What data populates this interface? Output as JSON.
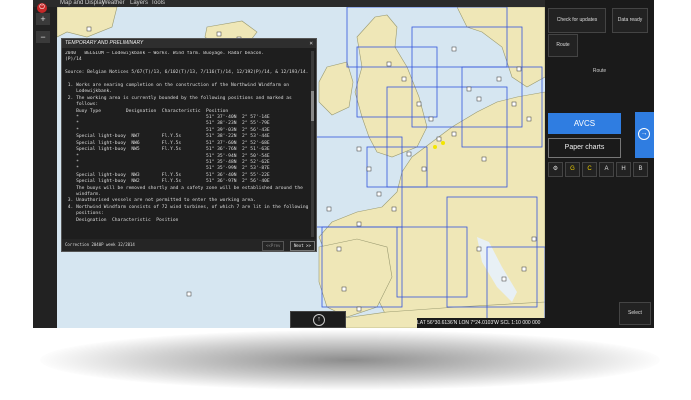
{
  "menu": {
    "items": [
      "Map and Display",
      "Weather",
      "Layers",
      "Tools"
    ]
  },
  "left_toolbar": {
    "zoom_in": "+",
    "zoom_out": "−",
    "logo": "⏻"
  },
  "right_panel": {
    "check_updates": "Check for updates",
    "data_ready": "Data ready",
    "route_button": "Route",
    "route_label": "Route",
    "avcs": "AVCS",
    "paper_charts": "Paper charts",
    "arrow": "→",
    "filters": [
      "⚙",
      "G",
      "C",
      "A",
      "H",
      "B"
    ],
    "select": "Select"
  },
  "notice": {
    "header": "TEMPORARY AND PRELIMINARY",
    "close": "×",
    "body": "2040   BELGIUM — Lodewijkbank — Works. Wind farm. Buoyage. Radar beacon.\n(P)/14\n\nSource: Belgian Notices 5/67(T)/13, 6/102(T)/13, 7/116(T)/14, 12/192(P)/14, & 12/193/14.\n\n 1. Works are nearing completion on the construction of the Northwind Windfarm on\n    Lodewijkbank.\n 2. The working area is currently bounded by the following positions and marked as\n    follows:\n    Buoy Type         Designation  Characteristic  Position\n    *                                              51° 37'·40N  2° 57'·14E\n    *                                              51° 38'·23N  2° 55'·79E\n    *                                              51° 39'·03N  2° 56'·43E\n    Special light-buoy  NW7        Fl.Y.5s         51° 38'·22N  2° 53'·44E\n    Special light-buoy  NW6        Fl.Y.5s         51° 37'·60N  2° 52'·68E\n    Special light-buoy  NW5        Fl.Y.5s         51° 36'·76N  2° 51'·63E\n    *                                              51° 35'·94N  2° 50'·54E\n    *                                              51° 35'·48N  2° 52'·62E\n    *                                              51° 35'·99N  2° 53'·87E\n    Special light-buoy  NW3        Fl.Y.5s         51° 36'·40N  2° 55'·22E\n    Special light-buoy  NW2        Fl.Y.5s         51° 36'·97N  2° 56'·40E\n    The buoys will be removed shortly and a safety zone will be established around the\n    windfarm.\n 3. Unauthorised vessels are not permitted to enter the working area.\n 4. Northwind Windfarm consists of 72 wind turbines, of which 7 are lit in the following\n    positions:\n    Designation  Characteristic  Position",
    "footer": "Correction 2040P week 32/2014",
    "prev": "<<Prev",
    "next": "Next >>"
  },
  "status": {
    "lat": "LAT 56°30.6136'N",
    "lon": "LON 7°24.0103'W",
    "scale": "SCL 1:10 000 000"
  },
  "map": {
    "up_arrow": "↑"
  },
  "colors": {
    "sea": "#d6e6f1",
    "land": "#efe7b7",
    "grid": "#3355dd",
    "accent": "#2f7de1"
  }
}
